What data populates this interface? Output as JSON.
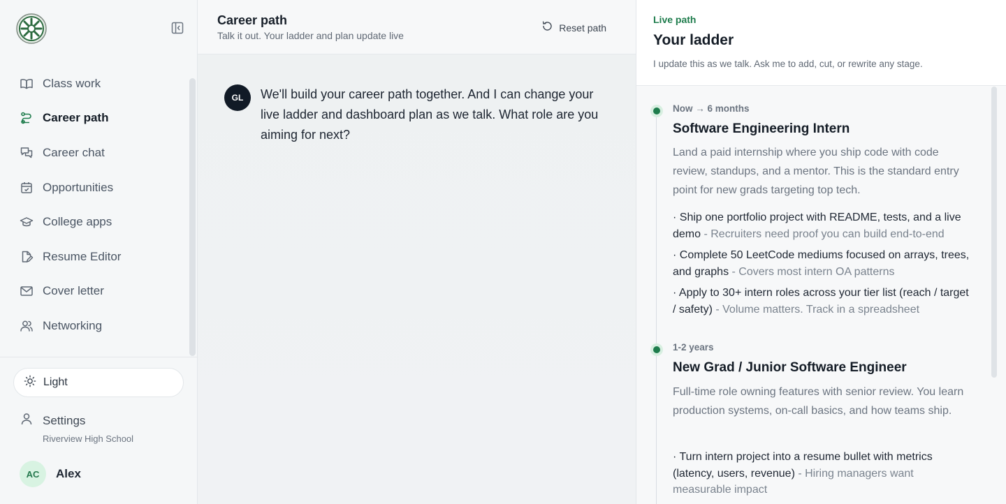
{
  "sidebar": {
    "logo": "school-logo",
    "nav": [
      {
        "label": "Class work",
        "icon": "book-icon",
        "active": false
      },
      {
        "label": "Career path",
        "icon": "route-icon",
        "active": true
      },
      {
        "label": "Career chat",
        "icon": "chat-icon",
        "active": false
      },
      {
        "label": "Opportunities",
        "icon": "calendar-check-icon",
        "active": false
      },
      {
        "label": "College apps",
        "icon": "graduation-cap-icon",
        "active": false
      },
      {
        "label": "Resume Editor",
        "icon": "file-edit-icon",
        "active": false
      },
      {
        "label": "Cover letter",
        "icon": "mail-icon",
        "active": false
      },
      {
        "label": "Networking",
        "icon": "users-icon",
        "active": false
      }
    ],
    "theme_label": "Light",
    "settings_label": "Settings",
    "school": "Riverview High School",
    "user_initials": "AC",
    "user_name": "Alex"
  },
  "center": {
    "title": "Career path",
    "subtitle": "Talk it out. Your ladder and plan update live",
    "reset_label": "Reset path",
    "message": {
      "initials": "GL",
      "text": "We'll build your career path together. And I can change your live ladder and dashboard plan as we talk. What role are you aiming for next?"
    }
  },
  "panel": {
    "kicker": "Live path",
    "title": "Your ladder",
    "subtitle": "I update this as we talk. Ask me to add, cut, or rewrite any stage.",
    "stages": [
      {
        "when": "Now → 6 months",
        "title": "Software Engineering Intern",
        "description": "Land a paid internship where you ship code with code review, standups, and a mentor. This is the standard entry point for new grads targeting top tech.",
        "bullets": [
          {
            "text": "· Ship one portfolio project with README, tests, and a live demo",
            "why": " - Recruiters need proof you can build end-to-end"
          },
          {
            "text": "· Complete 50 LeetCode mediums focused on arrays, trees, and graphs",
            "why": " - Covers most intern OA patterns"
          },
          {
            "text": "· Apply to 30+ intern roles across your tier list (reach / target / safety)",
            "why": " - Volume matters. Track in a spreadsheet"
          }
        ]
      },
      {
        "when": "1-2 years",
        "title": "New Grad / Junior Software Engineer",
        "description": "Full-time role owning features with senior review. You learn production systems, on-call basics, and how teams ship.",
        "bullets": [
          {
            "text": "· Turn intern project into a resume bullet with metrics (latency, users, revenue)",
            "why": " - Hiring managers want measurable impact"
          }
        ]
      }
    ]
  },
  "colors": {
    "accent": "#1e7c4c",
    "avatar_dark": "#111a26",
    "user_avatar_bg": "#d8f3e2"
  }
}
